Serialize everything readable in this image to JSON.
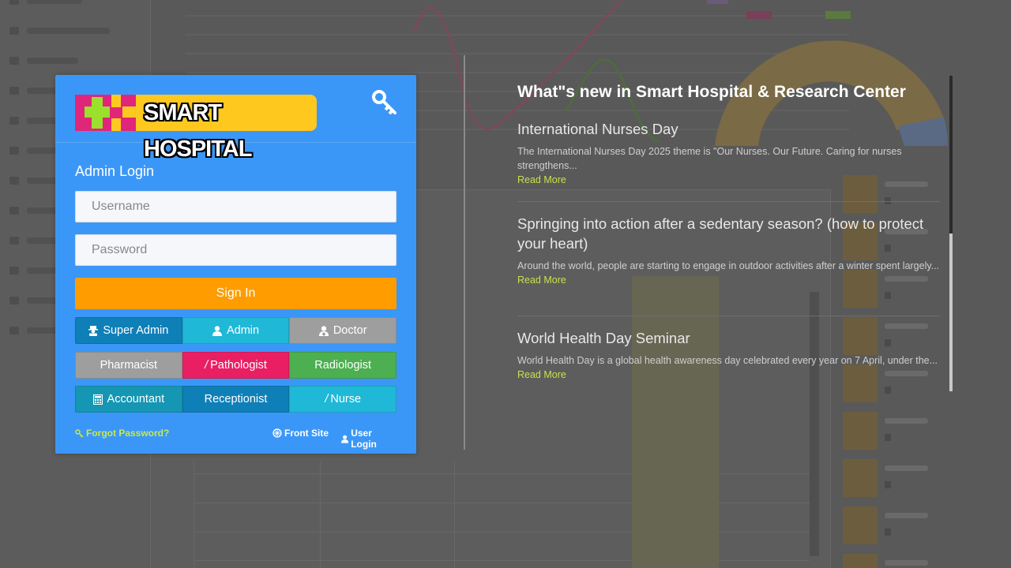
{
  "brand": {
    "logo_text": "SMART HOSPITAL",
    "colors": {
      "panel_blue": "#3b97f7",
      "logo_yellow": "#ffc81f",
      "logo_magenta": "#e0267a",
      "logo_green": "#9be02d",
      "signin_orange": "#ff9c00",
      "link_green": "#c6e24b"
    }
  },
  "login": {
    "title": "Admin Login",
    "username_placeholder": "Username",
    "password_placeholder": "Password",
    "signin_label": "Sign In",
    "header_icon": "key-icon",
    "roles": [
      {
        "label": "Super Admin",
        "icon": "user-secret-icon",
        "color": "#0f7fb7"
      },
      {
        "label": "Admin",
        "icon": "user-icon",
        "color": "#1fb8d6"
      },
      {
        "label": "Doctor",
        "icon": "user-md-icon",
        "color": "#9e9e9e"
      },
      {
        "label": "Pharmacist",
        "icon": "",
        "color": "#9e9e9e"
      },
      {
        "label": "Pathologist",
        "icon": "flask-icon",
        "color": "#ea1f63"
      },
      {
        "label": "Radiologist",
        "icon": "",
        "color": "#4caf50"
      },
      {
        "label": "Accountant",
        "icon": "calculator-icon",
        "color": "#1596b3"
      },
      {
        "label": "Receptionist",
        "icon": "",
        "color": "#0f7fb7"
      },
      {
        "label": "Nurse",
        "icon": "nurse-icon",
        "color": "#1fb8d6"
      }
    ],
    "forgot_password": "Forgot Password?",
    "front_site": "Front Site",
    "user_login": "User Login"
  },
  "news": {
    "heading": "What\"s new in Smart Hospital & Research Center",
    "items": [
      {
        "title": "International Nurses Day",
        "excerpt": "The International Nurses Day 2025 theme is \"Our Nurses. Our Future. Caring for nurses strengthens...",
        "more": "Read More"
      },
      {
        "title": "Springing into action after a sedentary season? (how to protect your heart)",
        "excerpt": "Around the world, people are starting to engage in outdoor activities after a winter spent largely...",
        "more": "Read More"
      },
      {
        "title": "World Health Day Seminar",
        "excerpt": "World Health Day is a global health awareness day celebrated every year on 7 April, under the...",
        "more": "Read More"
      }
    ]
  }
}
